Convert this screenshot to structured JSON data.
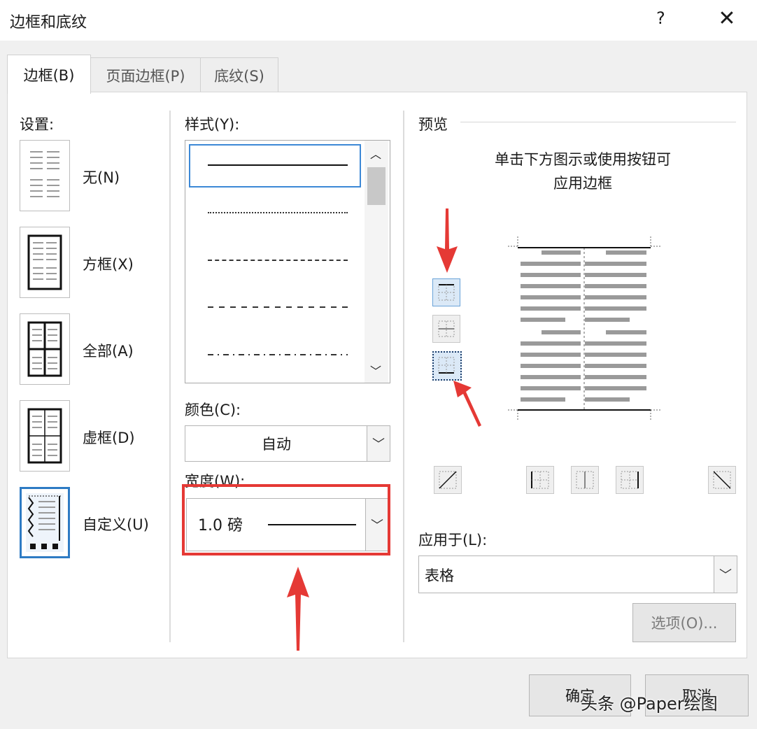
{
  "window": {
    "title": "边框和底纹",
    "help": "?",
    "close": "✕"
  },
  "tabs": [
    {
      "label": "边框(B)",
      "active": true
    },
    {
      "label": "页面边框(P)",
      "active": false
    },
    {
      "label": "底纹(S)",
      "active": false
    }
  ],
  "settings": {
    "header": "设置:",
    "items": [
      {
        "label": "无(N)"
      },
      {
        "label": "方框(X)"
      },
      {
        "label": "全部(A)"
      },
      {
        "label": "虚框(D)"
      },
      {
        "label": "自定义(U)",
        "selected": true
      }
    ]
  },
  "style": {
    "header": "样式(Y):",
    "options": [
      "solid",
      "dotted",
      "dashed-small",
      "dashed-large",
      "dash-dot"
    ],
    "selected_index": 0
  },
  "color": {
    "label": "颜色(C):",
    "value": "自动"
  },
  "width": {
    "label": "宽度(W):",
    "value": "1.0 磅"
  },
  "preview": {
    "header": "预览",
    "hint_line1": "单击下方图示或使用按钮可",
    "hint_line2": "应用边框"
  },
  "apply_to": {
    "label": "应用于(L):",
    "value": "表格"
  },
  "options_button": "选项(O)...",
  "ok_button": "确定",
  "cancel_button": "取消",
  "watermark": "头条 @Paper绘图",
  "colors": {
    "accent": "#2e7bc4",
    "highlight": "#e53935"
  }
}
